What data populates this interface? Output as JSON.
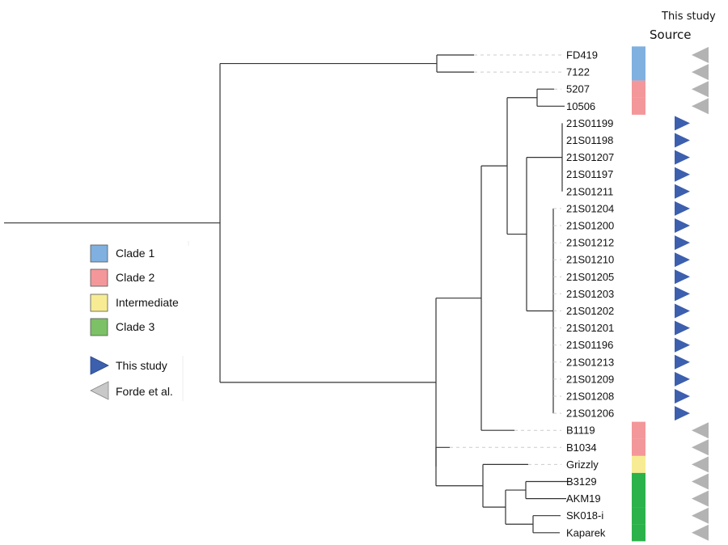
{
  "header": {
    "top_label": "This study",
    "source_label": "Source"
  },
  "colors": {
    "clade1": "#7fb0e0",
    "clade2": "#f4979a",
    "intermediate": "#f7ec94",
    "clade3": "#2bb24a",
    "this_study": "#3c5fae",
    "forde": "#b3b3b3"
  },
  "legend": {
    "clades": [
      {
        "label": "Clade 1",
        "color_key": "clade1"
      },
      {
        "label": "Clade 2",
        "color_key": "clade2"
      },
      {
        "label": "Intermediate",
        "color_key": "intermediate"
      },
      {
        "label": "Clade 3",
        "color_key": "clade3"
      }
    ],
    "sources": [
      {
        "label": "This study",
        "shape": "triangle-right",
        "color_key": "this_study"
      },
      {
        "label": "Forde et al.",
        "shape": "triangle-left",
        "color_key": "forde"
      }
    ]
  },
  "tips": [
    {
      "label": "FD419",
      "clade": "clade1",
      "source": "forde"
    },
    {
      "label": "7122",
      "clade": "clade1",
      "source": "forde"
    },
    {
      "label": "5207",
      "clade": "clade2",
      "source": "forde"
    },
    {
      "label": "10506",
      "clade": "clade2",
      "source": "forde"
    },
    {
      "label": "21S01199",
      "clade": null,
      "source": "this_study"
    },
    {
      "label": "21S01198",
      "clade": null,
      "source": "this_study"
    },
    {
      "label": "21S01207",
      "clade": null,
      "source": "this_study"
    },
    {
      "label": "21S01197",
      "clade": null,
      "source": "this_study"
    },
    {
      "label": "21S01211",
      "clade": null,
      "source": "this_study"
    },
    {
      "label": "21S01204",
      "clade": null,
      "source": "this_study"
    },
    {
      "label": "21S01200",
      "clade": null,
      "source": "this_study"
    },
    {
      "label": "21S01212",
      "clade": null,
      "source": "this_study"
    },
    {
      "label": "21S01210",
      "clade": null,
      "source": "this_study"
    },
    {
      "label": "21S01205",
      "clade": null,
      "source": "this_study"
    },
    {
      "label": "21S01203",
      "clade": null,
      "source": "this_study"
    },
    {
      "label": "21S01202",
      "clade": null,
      "source": "this_study"
    },
    {
      "label": "21S01201",
      "clade": null,
      "source": "this_study"
    },
    {
      "label": "21S01196",
      "clade": null,
      "source": "this_study"
    },
    {
      "label": "21S01213",
      "clade": null,
      "source": "this_study"
    },
    {
      "label": "21S01209",
      "clade": null,
      "source": "this_study"
    },
    {
      "label": "21S01208",
      "clade": null,
      "source": "this_study"
    },
    {
      "label": "21S01206",
      "clade": null,
      "source": "this_study"
    },
    {
      "label": "B1119",
      "clade": "clade2",
      "source": "forde"
    },
    {
      "label": "B1034",
      "clade": "clade2",
      "source": "forde"
    },
    {
      "label": "Grizzly",
      "clade": "intermediate",
      "source": "forde"
    },
    {
      "label": "B3129",
      "clade": "clade3",
      "source": "forde"
    },
    {
      "label": "AKM19",
      "clade": "clade3",
      "source": "forde"
    },
    {
      "label": "SK018-i",
      "clade": "clade3",
      "source": "forde"
    },
    {
      "label": "Kaparek",
      "clade": "clade3",
      "source": "forde"
    }
  ]
}
